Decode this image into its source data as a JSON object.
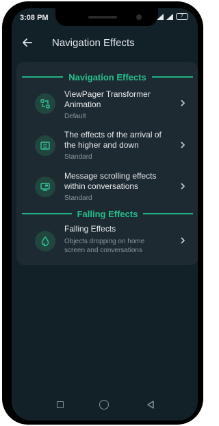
{
  "status": {
    "time": "3:08 PM",
    "battery": "7"
  },
  "appbar": {
    "title": "Navigation Effects",
    "back_icon": "arrow-left-icon"
  },
  "sections": [
    {
      "header": "Navigation Effects",
      "items": [
        {
          "title_line1": "ViewPager Transformer",
          "title_line2": "Animation",
          "subtitle_line1": "Default",
          "icon": "transform-icon"
        },
        {
          "title_line1": "The effects of the arrival of",
          "title_line2": "the higher and down",
          "subtitle_line1": "Standard",
          "icon": "window-icon"
        },
        {
          "title_line1": "Message scrolling effects",
          "title_line2": "within conversations",
          "subtitle_line1": "Standard",
          "icon": "message-screen-icon"
        }
      ]
    },
    {
      "header": "Falling Effects",
      "items": [
        {
          "title_line1": "Falling Effects",
          "subtitle_line1": "Objects dropping on home",
          "subtitle_line2": "screen and conversations",
          "icon": "drop-icon"
        }
      ]
    }
  ],
  "colors": {
    "accent": "#24c08c",
    "background": "#122028",
    "card": "#1e2a31"
  }
}
